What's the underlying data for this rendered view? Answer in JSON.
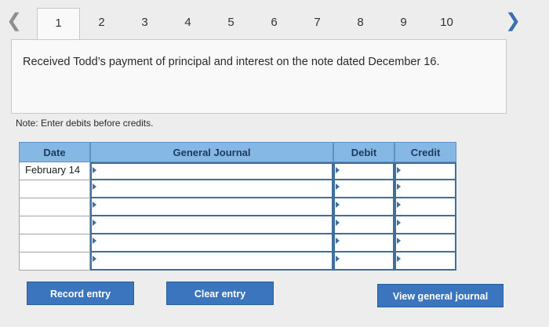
{
  "pagination": {
    "prev_icon": "chevron-left-icon",
    "next_icon": "chevron-right-icon",
    "tabs": [
      "1",
      "2",
      "3",
      "4",
      "5",
      "6",
      "7",
      "8",
      "9",
      "10"
    ],
    "active_tab": "1"
  },
  "instruction": "Received Todd’s payment of principal and interest on the note dated December 16.",
  "note": "Note: Enter debits before credits.",
  "journal": {
    "headers": {
      "date": "Date",
      "general_journal": "General Journal",
      "debit": "Debit",
      "credit": "Credit"
    },
    "rows": [
      {
        "date": "February 14",
        "account": "",
        "debit": "",
        "credit": ""
      },
      {
        "date": "",
        "account": "",
        "debit": "",
        "credit": ""
      },
      {
        "date": "",
        "account": "",
        "debit": "",
        "credit": ""
      },
      {
        "date": "",
        "account": "",
        "debit": "",
        "credit": ""
      },
      {
        "date": "",
        "account": "",
        "debit": "",
        "credit": ""
      },
      {
        "date": "",
        "account": "",
        "debit": "",
        "credit": ""
      }
    ]
  },
  "buttons": {
    "record": "Record entry",
    "clear": "Clear entry",
    "view": "View general journal"
  },
  "colors": {
    "header_bg": "#86b8e6",
    "button_bg": "#3a75be",
    "input_border": "#3f6f9f"
  }
}
